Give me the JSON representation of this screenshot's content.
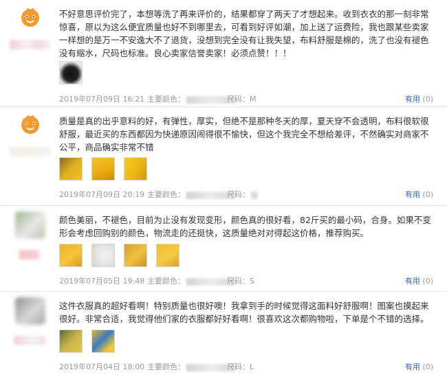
{
  "reviews": [
    {
      "text": "不好意思评价完了，本想等洗了再来评价的，结果都穿了两天了才想起来。收到衣衣的那一刻非常惊喜，原以为这么便宜质量也好不到哪里去，可看到好评如潮，加上送了运费险，我也跟某些卖家一样想的是万一不安逸大不了退货，没想到完全没有让我失望，布料舒服是棉的，洗了也没有褪色没有缩水，尺码也标准。良心卖家信誉卖家！必须点赞！！！",
      "date": "2019年07月09日 16:21",
      "color_label": "主要颜色：",
      "size_label": "尺码：",
      "size": "M",
      "useful_label": "有用",
      "useful_count": "(0)",
      "avatar": "orange-mascot-icon"
    },
    {
      "text": "质量是真的出乎意料的好，有弹性，厚实，但绝不是那种冬天的厚，夏天穿不会透明，布料很软很舒服，最近买的东西都因为快递原因闹得很不愉快，但这个我完全不想给差评，不然确实对商家不公平，商品确实非常不错",
      "date": "2019年07月09日 20:19",
      "color_label": "主要颜色：",
      "size_label": "尺码：",
      "size": "",
      "useful_label": "有用",
      "useful_count": "(0)",
      "avatar": "orange-mascot-icon"
    },
    {
      "text": "颜色美丽，不褪色，目前为止没有发现变形，颜色真的很好看，82斤买的最小码，合身。如果不变形会考虑回购别的颜色，物流走的还挺快，这质量绝对对得起这价格，推荐购买。",
      "date": "2019年07月05日 19:48",
      "color_label": "主要颜色：",
      "size_label": "尺码：",
      "size": "S",
      "useful_label": "有用",
      "useful_count": "(0)",
      "avatar": "blurred-photo"
    },
    {
      "text": "这件衣服真的超好看啊！特别质量也很好噢！我拿到手的时候觉得这面料好舒服啊！图案也摸起来很好。非常合适，我觉得他们家的衣服都好好看啊！很喜欢这次都购物啦，下单是个不错的选择。",
      "date": "2019年07月04日 18:00",
      "color_label": "主要颜色：",
      "size_label": "尺码：",
      "size": "L",
      "useful_label": "有用",
      "useful_count": "(0)",
      "avatar": "blurred-photo"
    }
  ]
}
